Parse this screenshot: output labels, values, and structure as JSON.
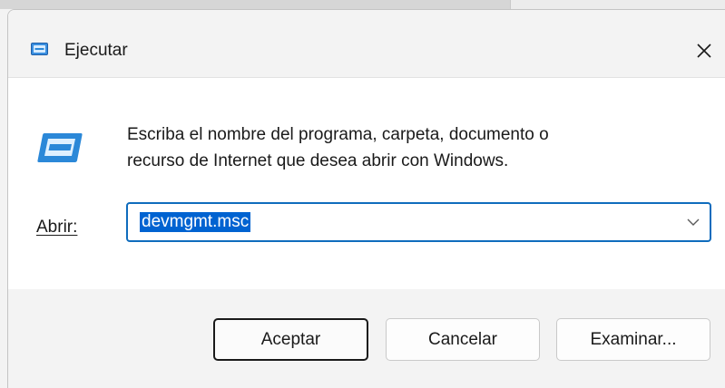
{
  "window": {
    "title": "Ejecutar",
    "icon": "run-dialog-icon",
    "close_icon": "close-icon"
  },
  "content": {
    "description_line1": "Escriba el nombre del programa, carpeta, documento o",
    "description_line2": "recurso de Internet que desea abrir con Windows.",
    "open_label": "Abrir:",
    "open_value": "devmgmt.msc",
    "dropdown_icon": "chevron-down-icon"
  },
  "buttons": {
    "ok": "Aceptar",
    "cancel": "Cancelar",
    "browse": "Examinar..."
  },
  "colors": {
    "accent": "#0f6cbd",
    "selection": "#0063d1",
    "icon_blue": "#2b88d8"
  }
}
